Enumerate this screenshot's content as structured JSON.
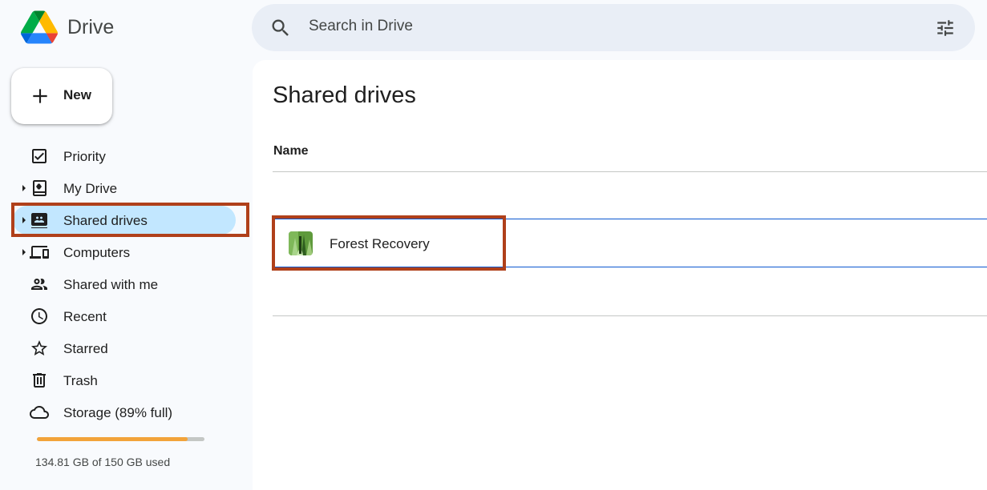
{
  "app": {
    "title": "Drive"
  },
  "search": {
    "placeholder": "Search in Drive"
  },
  "new_button": {
    "label": "New"
  },
  "sidebar": {
    "items": [
      {
        "label": "Priority",
        "icon": "priority-icon"
      },
      {
        "label": "My Drive",
        "icon": "my-drive-icon"
      },
      {
        "label": "Shared drives",
        "icon": "shared-drives-icon",
        "active": true
      },
      {
        "label": "Computers",
        "icon": "computers-icon"
      },
      {
        "label": "Shared with me",
        "icon": "shared-with-me-icon"
      },
      {
        "label": "Recent",
        "icon": "clock-icon"
      },
      {
        "label": "Starred",
        "icon": "star-icon"
      },
      {
        "label": "Trash",
        "icon": "trash-icon"
      },
      {
        "label": "Storage (89% full)",
        "icon": "cloud-icon"
      }
    ]
  },
  "storage": {
    "used_text": "134.81 GB of 150 GB used",
    "fraction_used": 0.8987
  },
  "main": {
    "title": "Shared drives",
    "column_name": "Name",
    "drives": [
      {
        "name": "Forest Recovery"
      }
    ]
  },
  "colors": {
    "highlight": "#b0401a",
    "active_nav": "#c2e7ff",
    "storage_fill": "#f2a33a",
    "row_border": "#0b57d0"
  }
}
